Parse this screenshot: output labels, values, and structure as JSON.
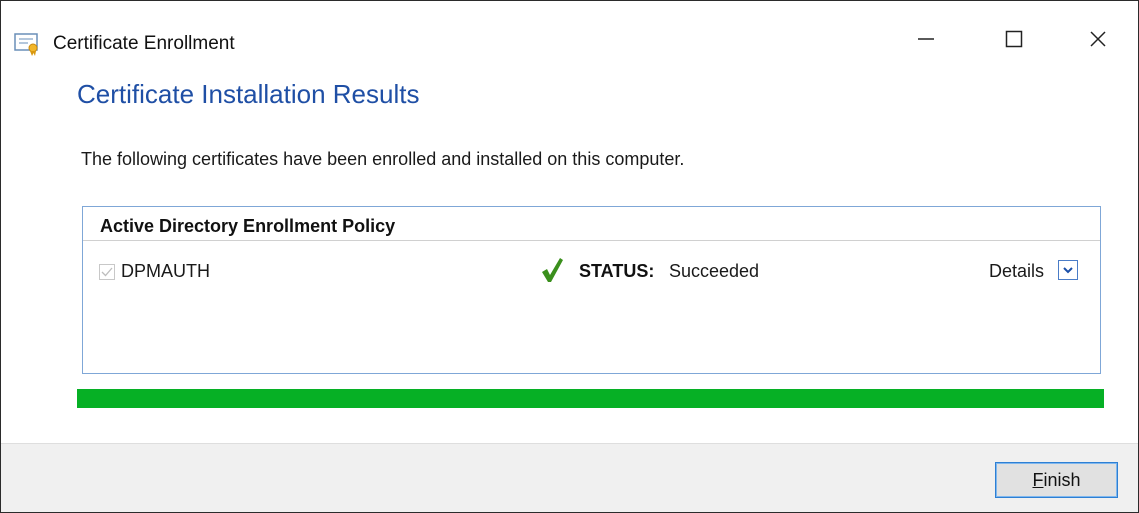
{
  "window": {
    "title": "Certificate Enrollment",
    "icon": "certificate-icon",
    "controls": [
      "minimize-icon",
      "maximize-icon",
      "close-icon"
    ]
  },
  "page": {
    "title": "Certificate Installation Results",
    "description": "The following certificates have been enrolled and installed on this computer."
  },
  "policy": {
    "name": "Active Directory Enrollment Policy",
    "certificates": [
      {
        "name": "DPMAUTH",
        "checked": true,
        "status_label": "STATUS:",
        "status_value": "Succeeded",
        "status_icon": "checkmark-icon",
        "details_label": "Details"
      }
    ]
  },
  "progress": {
    "percent": 100,
    "color": "#06b025"
  },
  "footer": {
    "finish_accel": "F",
    "finish_rest": "inish"
  },
  "colors": {
    "title_blue": "#1f4fa5",
    "panel_border": "#7fa7d7",
    "button_focus": "#2e7fd3"
  }
}
